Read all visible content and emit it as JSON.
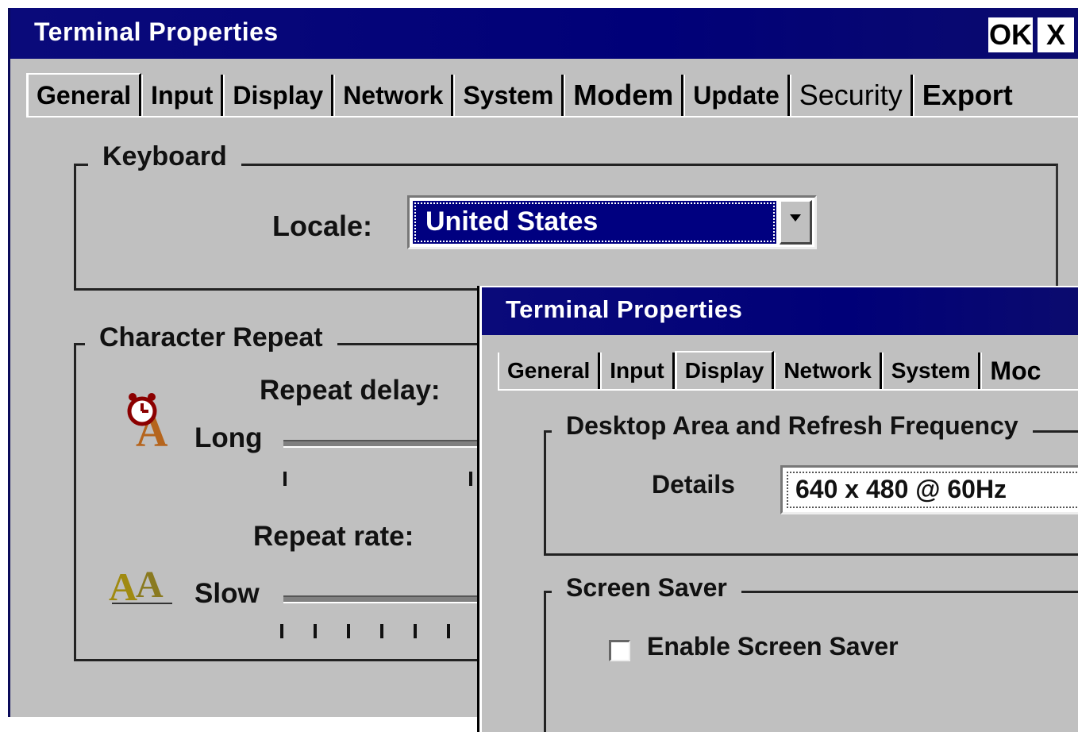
{
  "main_window": {
    "title": "Terminal Properties",
    "ok_label": "OK",
    "close_label": "X",
    "tabs": [
      {
        "label": "General"
      },
      {
        "label": "Input"
      },
      {
        "label": "Display"
      },
      {
        "label": "Network"
      },
      {
        "label": "System"
      },
      {
        "label": "Modem"
      },
      {
        "label": "Update"
      },
      {
        "label": "Security"
      },
      {
        "label": "Export"
      }
    ],
    "keyboard": {
      "group_label": "Keyboard",
      "locale_label": "Locale:",
      "locale_value": "United States"
    },
    "character_repeat": {
      "group_label": "Character Repeat",
      "repeat_delay_label": "Repeat delay:",
      "long_label": "Long",
      "repeat_rate_label": "Repeat rate:",
      "slow_label": "Slow"
    }
  },
  "display_window": {
    "title": "Terminal Properties",
    "tabs": [
      {
        "label": "General"
      },
      {
        "label": "Input"
      },
      {
        "label": "Display"
      },
      {
        "label": "Network"
      },
      {
        "label": "System"
      },
      {
        "label": "Moc"
      }
    ],
    "desktop_area": {
      "group_label": "Desktop Area and Refresh Frequency",
      "details_label": "Details",
      "details_value": "640 x 480 @ 60Hz"
    },
    "screen_saver": {
      "group_label": "Screen Saver",
      "enable_label": "Enable Screen Saver",
      "enabled": false
    }
  },
  "colors": {
    "titlebar": "#000078",
    "face": "#c0c0c0",
    "selection": "#000080"
  }
}
